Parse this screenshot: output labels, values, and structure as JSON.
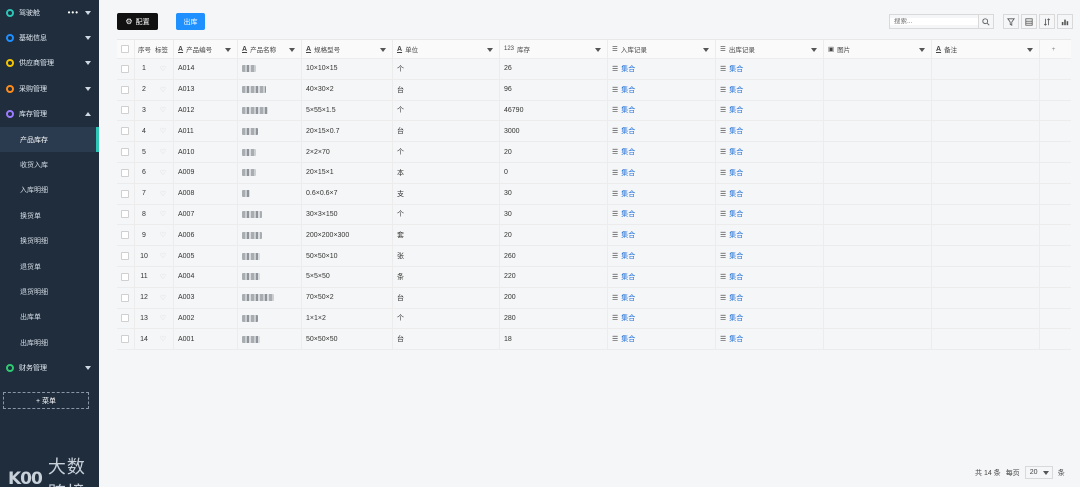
{
  "sidebar": {
    "top": {
      "label": "驾驶舱",
      "dots": "•••",
      "color": "#2ec4b6"
    },
    "groups": [
      {
        "label": "基础信息",
        "color": "#1e90ff"
      },
      {
        "label": "供应商管理",
        "color": "#f5c400"
      },
      {
        "label": "采购管理",
        "color": "#ff8c1a"
      },
      {
        "label": "库存管理",
        "color": "#9b7bff"
      }
    ],
    "sub_items": [
      "产品库存",
      "收货入库",
      "入库明细",
      "换货单",
      "换货明细",
      "退货单",
      "退货明细",
      "出库单",
      "出库明细"
    ],
    "finance": {
      "label": "财务管理",
      "color": "#2ecc71"
    },
    "add_menu": "+ 菜单",
    "logo_mark": "K00",
    "logo_name": "大数跨境"
  },
  "toolbar": {
    "config_label": "配置",
    "out_label": "出库"
  },
  "search": {
    "placeholder": "搜索..."
  },
  "table": {
    "columns": [
      "序号",
      "标签",
      "产品编号",
      "产品名称",
      "规格型号",
      "单位",
      "库存",
      "入库记录",
      "出库记录",
      "图片",
      "备注"
    ],
    "stock_prefix": "123",
    "link_text": "集合",
    "rows": [
      {
        "seq": "1",
        "code": "A014",
        "spec": "10×10×15",
        "unit": "个",
        "stock": "26"
      },
      {
        "seq": "2",
        "code": "A013",
        "spec": "40×30×2",
        "unit": "台",
        "stock": "96"
      },
      {
        "seq": "3",
        "code": "A012",
        "spec": "5×55×1.5",
        "unit": "个",
        "stock": "46790"
      },
      {
        "seq": "4",
        "code": "A011",
        "spec": "20×15×0.7",
        "unit": "台",
        "stock": "3000"
      },
      {
        "seq": "5",
        "code": "A010",
        "spec": "2×2×70",
        "unit": "个",
        "stock": "20"
      },
      {
        "seq": "6",
        "code": "A009",
        "spec": "20×15×1",
        "unit": "本",
        "stock": "0"
      },
      {
        "seq": "7",
        "code": "A008",
        "spec": "0.6×0.6×7",
        "unit": "支",
        "stock": "30"
      },
      {
        "seq": "8",
        "code": "A007",
        "spec": "30×3×150",
        "unit": "个",
        "stock": "30"
      },
      {
        "seq": "9",
        "code": "A006",
        "spec": "200×200×300",
        "unit": "套",
        "stock": "20"
      },
      {
        "seq": "10",
        "code": "A005",
        "spec": "50×50×10",
        "unit": "张",
        "stock": "260"
      },
      {
        "seq": "11",
        "code": "A004",
        "spec": "5×5×50",
        "unit": "条",
        "stock": "220"
      },
      {
        "seq": "12",
        "code": "A003",
        "spec": "70×50×2",
        "unit": "台",
        "stock": "200"
      },
      {
        "seq": "13",
        "code": "A002",
        "spec": "1×1×2",
        "unit": "个",
        "stock": "280"
      },
      {
        "seq": "14",
        "code": "A001",
        "spec": "50×50×50",
        "unit": "台",
        "stock": "18"
      }
    ]
  },
  "footer": {
    "total": "共 14 条",
    "per_page_label": "每页",
    "page_size": "20",
    "unit": "条"
  }
}
